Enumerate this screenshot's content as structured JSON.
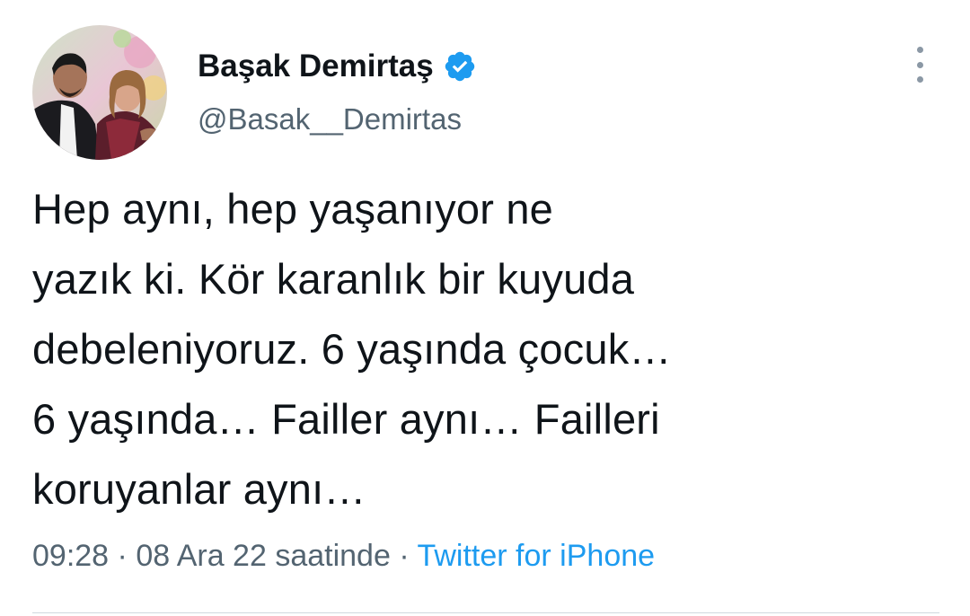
{
  "author": {
    "display_name": "Başak Demirtaş",
    "handle": "@Basak__Demirtas",
    "verified_icon": "verified-badge-icon",
    "avatar_icon": "profile-photo"
  },
  "menu": {
    "icon": "more-options-icon"
  },
  "tweet": {
    "lines": [
      "Hep aynı, hep yaşanıyor ne",
      "yazık ki. Kör karanlık bir kuyuda",
      "debeleniyoruz. 6 yaşında çocuk…",
      "6 yaşında… Failler aynı… Failleri",
      "koruyanlar aynı…"
    ]
  },
  "meta": {
    "time": "09:28",
    "separator1": " · ",
    "date": "08 Ara 22 saatinde",
    "separator2": " · ",
    "source": "Twitter for iPhone"
  },
  "colors": {
    "text": "#0f1419",
    "secondary": "#536471",
    "accent": "#1d9bf0",
    "divider": "#cfd9de"
  }
}
